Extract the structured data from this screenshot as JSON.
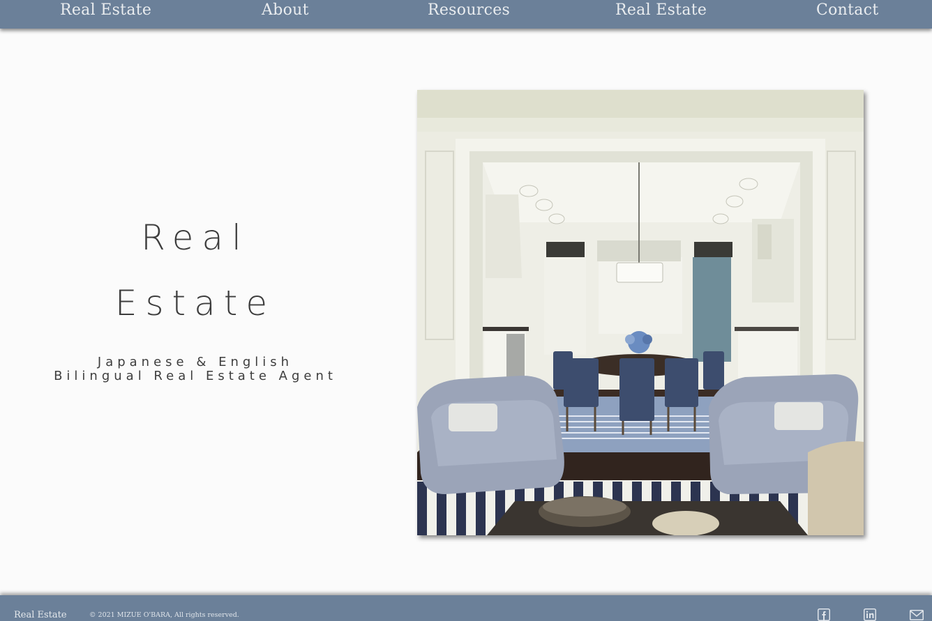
{
  "nav": {
    "items": [
      {
        "label": "Real Estate"
      },
      {
        "label": "About"
      },
      {
        "label": "Resources"
      },
      {
        "label": "Real Estate"
      },
      {
        "label": "Contact"
      }
    ]
  },
  "hero": {
    "title_line1": "Real",
    "title_line2": "Estate",
    "subtitle_line1": "Japanese & English",
    "subtitle_line2": "Bilingual Real Estate Agent"
  },
  "photo": {
    "subject": "interior-dining-room-photo"
  },
  "footer": {
    "brand": "Real Estate",
    "copyright": "© 2021 MIZUE O'BARA, All rights reserved.",
    "social": [
      "facebook-icon",
      "linkedin-icon",
      "mail-icon"
    ]
  },
  "colors": {
    "bar": "#6b8099",
    "background": "#fbfbfb",
    "text_dark": "#3d3d3d",
    "text_light": "#e9ecef"
  }
}
